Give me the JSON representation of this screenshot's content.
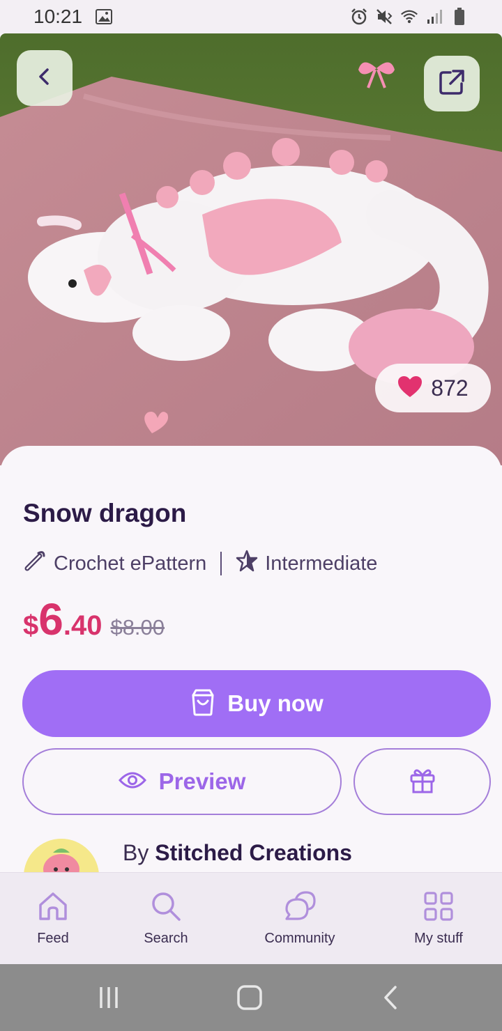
{
  "status_bar": {
    "time": "10:21",
    "icons": [
      "image-icon",
      "alarm-icon",
      "mute-icon",
      "wifi-icon",
      "signal-icon",
      "battery-icon"
    ]
  },
  "hero": {
    "likes": "872",
    "carousel_total": 9,
    "carousel_active": 2,
    "icons": [
      "back-arrow-icon",
      "share-external-icon",
      "heart-icon"
    ]
  },
  "product": {
    "title": "Snow dragon",
    "type": "Crochet ePattern",
    "difficulty": "Intermediate",
    "price": {
      "currency": "$",
      "whole": "6",
      "cents": ".40",
      "original": "$8.00"
    }
  },
  "actions": {
    "buy_label": "Buy now",
    "preview_label": "Preview"
  },
  "author": {
    "prefix": "By",
    "name": "Stitched Creations"
  },
  "bottom_nav": {
    "items": [
      {
        "label": "Feed",
        "icon": "home-icon"
      },
      {
        "label": "Search",
        "icon": "search-icon"
      },
      {
        "label": "Community",
        "icon": "chat-bubbles-icon"
      },
      {
        "label": "My stuff",
        "icon": "grid-icon"
      }
    ]
  },
  "colors": {
    "accent": "#a06ef5",
    "price": "#d8336c",
    "title": "#2c1b47"
  }
}
